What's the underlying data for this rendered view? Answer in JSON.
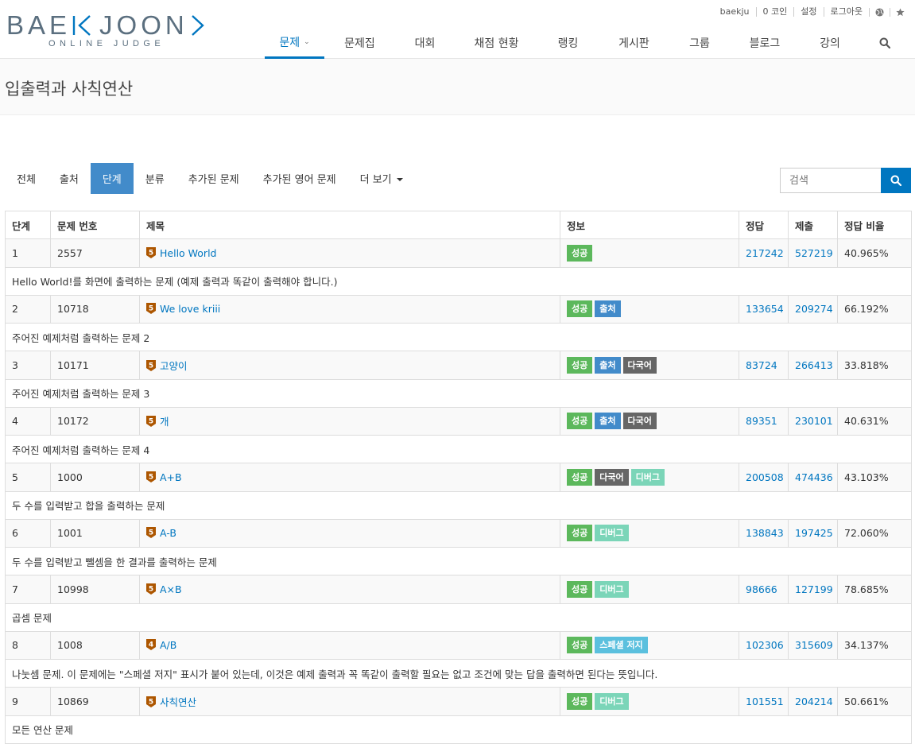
{
  "header": {
    "logo_main_left": "BAE",
    "logo_main_right": "JOON",
    "logo_sub": "ONLINE JUDGE",
    "user_menu": [
      "baekju",
      "0 코인",
      "설정",
      "로그아웃"
    ],
    "nav": [
      {
        "label": "문제",
        "active": true
      },
      {
        "label": "문제집"
      },
      {
        "label": "대회"
      },
      {
        "label": "채점 현황"
      },
      {
        "label": "랭킹"
      },
      {
        "label": "게시판"
      },
      {
        "label": "그룹"
      },
      {
        "label": "블로그"
      },
      {
        "label": "강의"
      }
    ]
  },
  "page_title": "입출력과 사칙연산",
  "tabs": [
    {
      "label": "전체"
    },
    {
      "label": "출처"
    },
    {
      "label": "단계",
      "active": true
    },
    {
      "label": "분류"
    },
    {
      "label": "추가된 문제"
    },
    {
      "label": "추가된 영어 문제"
    },
    {
      "label": "더 보기"
    }
  ],
  "search": {
    "placeholder": "검색"
  },
  "table": {
    "headers": [
      "단계",
      "문제 번호",
      "제목",
      "정보",
      "정답",
      "제출",
      "정답 비율"
    ],
    "rows": [
      {
        "step": "1",
        "id": "2557",
        "title": "Hello World",
        "tier": "5",
        "tier_color": "#ad5600",
        "badges": [
          "성공"
        ],
        "correct": "217242",
        "submit": "527219",
        "ratio": "40.965%",
        "desc": "Hello World!를 화면에 출력하는 문제 (예제 출력과 똑같이 출력해야 합니다.)"
      },
      {
        "step": "2",
        "id": "10718",
        "title": "We love kriii",
        "tier": "5",
        "tier_color": "#ad5600",
        "badges": [
          "성공",
          "출처"
        ],
        "correct": "133654",
        "submit": "209274",
        "ratio": "66.192%",
        "desc": "주어진 예제처럼 출력하는 문제 2"
      },
      {
        "step": "3",
        "id": "10171",
        "title": "고양이",
        "tier": "5",
        "tier_color": "#ad5600",
        "badges": [
          "성공",
          "출처",
          "다국어"
        ],
        "correct": "83724",
        "submit": "266413",
        "ratio": "33.818%",
        "desc": "주어진 예제처럼 출력하는 문제 3"
      },
      {
        "step": "4",
        "id": "10172",
        "title": "개",
        "tier": "5",
        "tier_color": "#ad5600",
        "badges": [
          "성공",
          "출처",
          "다국어"
        ],
        "correct": "89351",
        "submit": "230101",
        "ratio": "40.631%",
        "desc": "주어진 예제처럼 출력하는 문제 4"
      },
      {
        "step": "5",
        "id": "1000",
        "title": "A+B",
        "tier": "5",
        "tier_color": "#ad5600",
        "badges": [
          "성공",
          "다국어",
          "디버그"
        ],
        "correct": "200508",
        "submit": "474436",
        "ratio": "43.103%",
        "desc": "두 수를 입력받고 합을 출력하는 문제"
      },
      {
        "step": "6",
        "id": "1001",
        "title": "A-B",
        "tier": "5",
        "tier_color": "#ad5600",
        "badges": [
          "성공",
          "디버그"
        ],
        "correct": "138843",
        "submit": "197425",
        "ratio": "72.060%",
        "desc": "두 수를 입력받고 뺄셈을 한 결과를 출력하는 문제"
      },
      {
        "step": "7",
        "id": "10998",
        "title": "A×B",
        "tier": "5",
        "tier_color": "#ad5600",
        "badges": [
          "성공",
          "디버그"
        ],
        "correct": "98666",
        "submit": "127199",
        "ratio": "78.685%",
        "desc": "곱셈 문제"
      },
      {
        "step": "8",
        "id": "1008",
        "title": "A/B",
        "tier": "4",
        "tier_color": "#ad5600",
        "badges": [
          "성공",
          "스페셜 저지"
        ],
        "correct": "102306",
        "submit": "315609",
        "ratio": "34.137%",
        "desc": "나눗셈 문제. 이 문제에는 \"스페셜 저지\" 표시가 붙어 있는데, 이것은 예제 출력과 꼭 똑같이 출력할 필요는 없고 조건에 맞는 답을 출력하면 된다는 뜻입니다."
      },
      {
        "step": "9",
        "id": "10869",
        "title": "사칙연산",
        "tier": "5",
        "tier_color": "#ad5600",
        "badges": [
          "성공",
          "디버그"
        ],
        "correct": "101551",
        "submit": "204214",
        "ratio": "50.661%",
        "desc": "모든 연산 문제"
      }
    ]
  },
  "colors": {
    "accent": "#0076c0",
    "tab_active": "#428bca",
    "success": "#5cb85c",
    "source": "#428bca",
    "multilang": "#666666",
    "debug": "#7bd5b8",
    "special": "#5bc0de"
  },
  "icons": [
    "globe-icon",
    "star-icon",
    "search-icon",
    "caret-down-icon",
    "bronze-tier-icon"
  ]
}
